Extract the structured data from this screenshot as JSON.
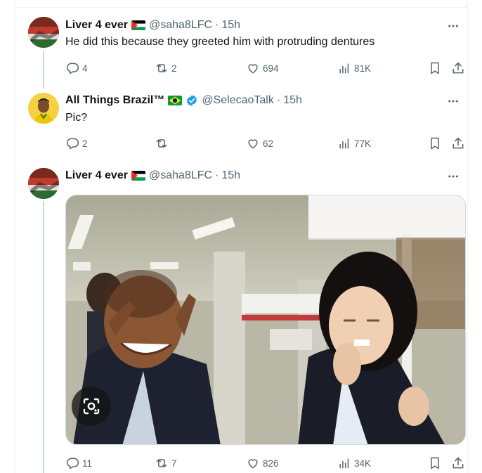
{
  "tweets": [
    {
      "name": "Liver 4 ever",
      "handle": "@saha8LFC",
      "time": "15h",
      "text": "He did this because they greeted him with protruding dentures",
      "replies": "4",
      "reposts": "2",
      "likes": "694",
      "views": "81K"
    },
    {
      "name": "All Things Brazil™",
      "handle": "@SelecaoTalk",
      "time": "15h",
      "text": "Pic?",
      "replies": "2",
      "reposts": "",
      "likes": "62",
      "views": "77K"
    },
    {
      "name": "Liver 4 ever",
      "handle": "@saha8LFC",
      "time": "15h",
      "text": "",
      "replies": "11",
      "reposts": "7",
      "likes": "826",
      "views": "34K"
    }
  ],
  "separator": "·",
  "colors": {
    "text_primary": "#0f1419",
    "text_secondary": "#536471",
    "verified_blue": "#1d9bf0",
    "border": "#cfd9de"
  }
}
